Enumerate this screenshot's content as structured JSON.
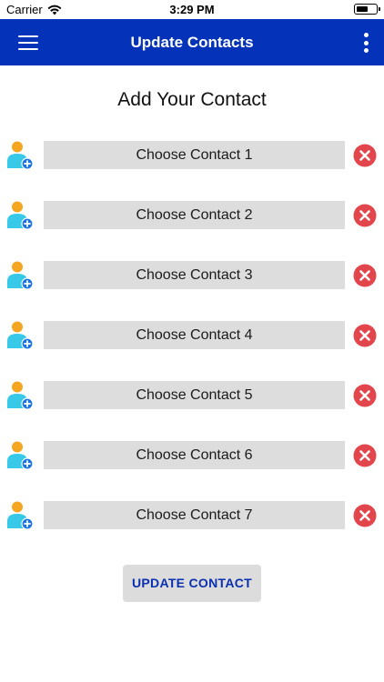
{
  "status_bar": {
    "carrier": "Carrier",
    "time": "3:29 PM"
  },
  "app_bar": {
    "title": "Update Contacts"
  },
  "heading": "Add Your Contact",
  "contacts": [
    {
      "label": "Choose Contact 1"
    },
    {
      "label": "Choose Contact 2"
    },
    {
      "label": "Choose Contact 3"
    },
    {
      "label": "Choose Contact 4"
    },
    {
      "label": "Choose Contact 5"
    },
    {
      "label": "Choose Contact 6"
    },
    {
      "label": "Choose Contact 7"
    }
  ],
  "update_button": {
    "label": "UPDATE CONTACT"
  },
  "colors": {
    "app_bar": "#0432b8",
    "field_bg": "#dddddd",
    "remove_red": "#e2454b",
    "button_text": "#0a2fb0",
    "avatar_head": "#f4a623",
    "avatar_body": "#39c9e8",
    "avatar_badge": "#1a73e8"
  },
  "icons": {
    "menu": "hamburger-icon",
    "more": "more-vertical-icon",
    "avatar": "add-person-icon",
    "remove": "close-circle-icon"
  }
}
